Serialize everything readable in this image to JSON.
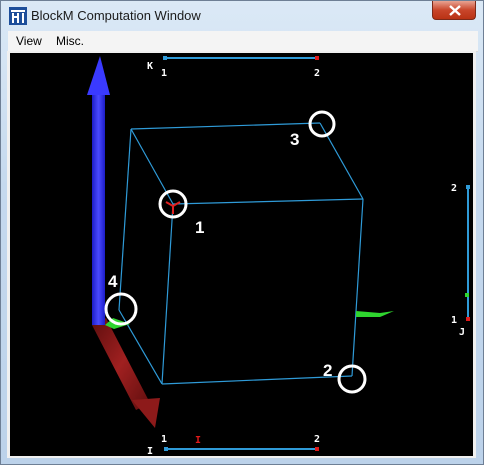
{
  "window": {
    "title": "BlockM Computation Window",
    "icon": "blockmesh-app-icon"
  },
  "menu": {
    "items": [
      {
        "label": "View"
      },
      {
        "label": "Misc."
      }
    ]
  },
  "scene": {
    "k_axis": {
      "letter": "K",
      "start": "1",
      "end": "2"
    },
    "i_axis": {
      "letter": "I",
      "start": "1",
      "end": "2",
      "current": "I"
    },
    "j_axis": {
      "letter": "J",
      "start": "1",
      "end": "2"
    },
    "vertex_markers": [
      "1",
      "2",
      "3",
      "4"
    ]
  },
  "colors": {
    "edge": "#2f9bd8",
    "marker": "#ffffff",
    "axis_blue": "#2b2bff",
    "axis_red": "#8a1616",
    "axis_green": "#2fd52f",
    "slider_end": "#e01a1a"
  }
}
